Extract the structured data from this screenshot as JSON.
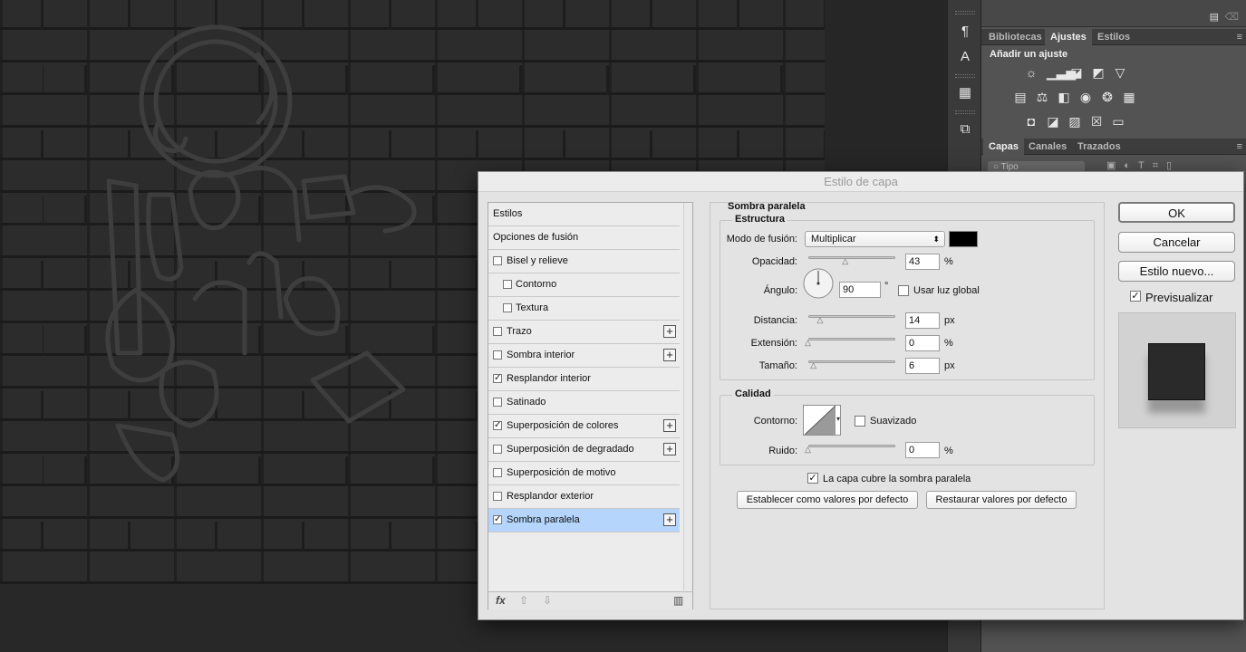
{
  "dialog": {
    "title": "Estilo de capa",
    "style_items": [
      {
        "label": "Estilos",
        "checkbox": false,
        "checked": false,
        "plus": false
      },
      {
        "label": "Opciones de fusión",
        "checkbox": false,
        "checked": false,
        "plus": false
      },
      {
        "label": "Bisel y relieve",
        "checkbox": true,
        "checked": false,
        "plus": false
      },
      {
        "label": "Contorno",
        "checkbox": true,
        "checked": false,
        "plus": false,
        "indent": true
      },
      {
        "label": "Textura",
        "checkbox": true,
        "checked": false,
        "plus": false,
        "indent": true
      },
      {
        "label": "Trazo",
        "checkbox": true,
        "checked": false,
        "plus": true
      },
      {
        "label": "Sombra interior",
        "checkbox": true,
        "checked": false,
        "plus": true
      },
      {
        "label": "Resplandor interior",
        "checkbox": true,
        "checked": true,
        "plus": false
      },
      {
        "label": "Satinado",
        "checkbox": true,
        "checked": false,
        "plus": false
      },
      {
        "label": "Superposición de colores",
        "checkbox": true,
        "checked": true,
        "plus": true
      },
      {
        "label": "Superposición de degradado",
        "checkbox": true,
        "checked": false,
        "plus": true
      },
      {
        "label": "Superposición de motivo",
        "checkbox": true,
        "checked": false,
        "plus": false
      },
      {
        "label": "Resplandor exterior",
        "checkbox": true,
        "checked": false,
        "plus": false
      },
      {
        "label": "Sombra paralela",
        "checkbox": true,
        "checked": true,
        "plus": true,
        "selected": true
      }
    ],
    "footer": {
      "fx": "fx",
      "up": "⇧",
      "down": "⇩",
      "trash": "🗑"
    },
    "settings": {
      "section_title": "Sombra paralela",
      "structure_title": "Estructura",
      "blend_mode_label": "Modo de fusión:",
      "blend_mode_value": "Multiplicar",
      "shadow_color": "#000000",
      "opacity_label": "Opacidad:",
      "opacity_value": "43",
      "opacity_unit": "%",
      "angle_label": "Ángulo:",
      "angle_value": "90",
      "angle_unit": "°",
      "global_light_label": "Usar luz global",
      "global_light_checked": false,
      "distance_label": "Distancia:",
      "distance_value": "14",
      "distance_unit": "px",
      "spread_label": "Extensión:",
      "spread_value": "0",
      "spread_unit": "%",
      "size_label": "Tamaño:",
      "size_value": "6",
      "size_unit": "px",
      "quality_title": "Calidad",
      "contour_label": "Contorno:",
      "antialias_label": "Suavizado",
      "antialias_checked": false,
      "noise_label": "Ruido:",
      "noise_value": "0",
      "noise_unit": "%",
      "knockout_label": "La capa cubre la sombra paralela",
      "knockout_checked": true,
      "set_default_label": "Establecer como valores por defecto",
      "reset_default_label": "Restaurar valores por defecto"
    },
    "buttons": {
      "ok": "OK",
      "cancel": "Cancelar",
      "new_style": "Estilo nuevo...",
      "preview_label": "Previsualizar",
      "preview_checked": true
    }
  },
  "panels": {
    "top_tabs": [
      "Bibliotecas",
      "Ajustes",
      "Estilos"
    ],
    "active_top_tab": "Ajustes",
    "adjustments_title": "Añadir un ajuste",
    "layer_tabs": [
      "Capas",
      "Canales",
      "Trazados"
    ],
    "active_layer_tab": "Capas",
    "layer_search_placeholder": "Tipo"
  }
}
